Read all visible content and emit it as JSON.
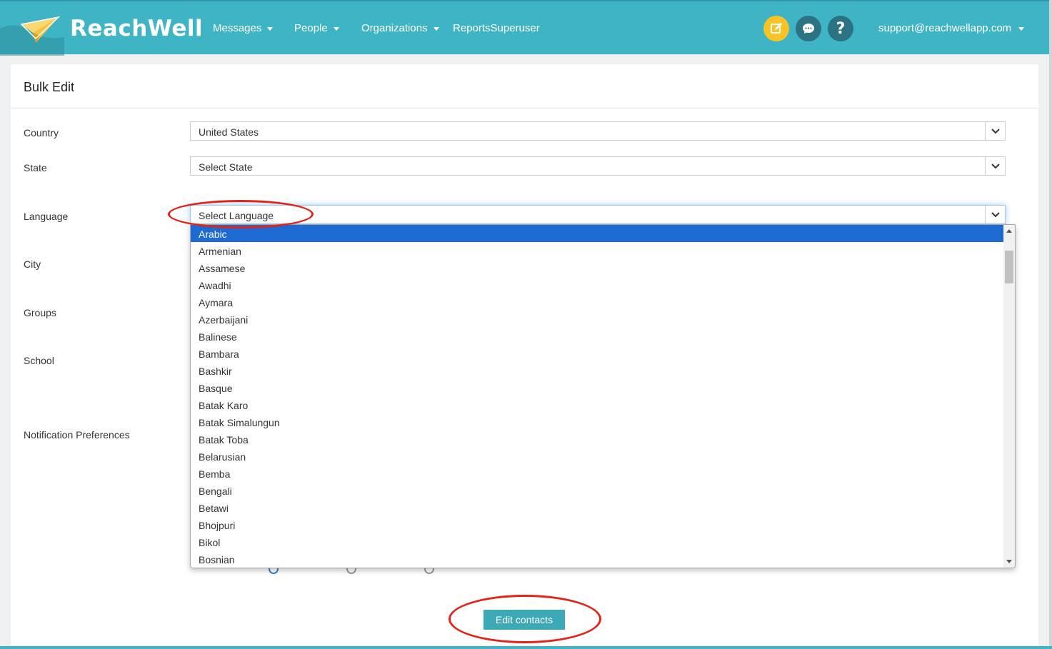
{
  "brand": {
    "name": "ReachWell",
    "primary_color": "#3fb4c5",
    "highlight_color": "#1e6ad3"
  },
  "nav": {
    "items": [
      {
        "label": "Messages",
        "has_caret": true
      },
      {
        "label": "People",
        "has_caret": true
      },
      {
        "label": "Organizations",
        "has_caret": true
      },
      {
        "label": "ReportsSuperuser",
        "has_caret": false
      }
    ],
    "icons": [
      "compose-icon",
      "chat-icon",
      "help-icon"
    ],
    "user_email": "support@reachwellapp.com"
  },
  "page": {
    "title": "Bulk Edit"
  },
  "form": {
    "country": {
      "label": "Country",
      "value": "United States"
    },
    "state": {
      "label": "State",
      "value": "Select State"
    },
    "language": {
      "label": "Language",
      "value": "Select Language"
    },
    "city": {
      "label": "City"
    },
    "groups": {
      "label": "Groups"
    },
    "school": {
      "label": "School"
    },
    "notifications": {
      "label": "Notification Preferences"
    },
    "submit_label": "Edit contacts"
  },
  "language_options": [
    "Arabic",
    "Armenian",
    "Assamese",
    "Awadhi",
    "Aymara",
    "Azerbaijani",
    "Balinese",
    "Bambara",
    "Bashkir",
    "Basque",
    "Batak Karo",
    "Batak Simalungun",
    "Batak Toba",
    "Belarusian",
    "Bemba",
    "Bengali",
    "Betawi",
    "Bhojpuri",
    "Bikol",
    "Bosnian"
  ],
  "language_selected": "Arabic"
}
